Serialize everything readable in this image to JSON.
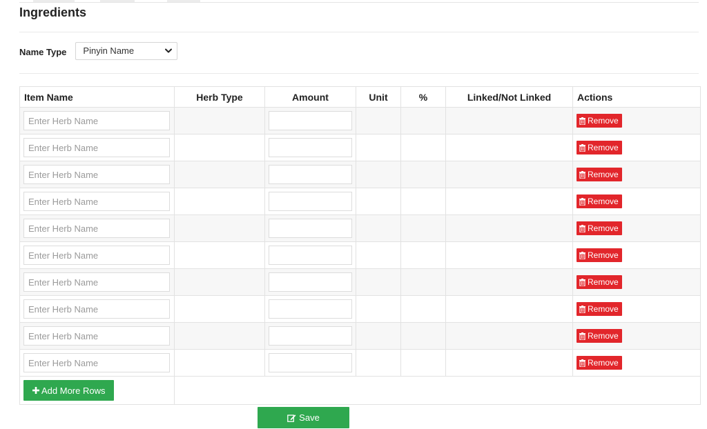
{
  "section": {
    "title": "Ingredients"
  },
  "name_type": {
    "label": "Name Type",
    "selected": "Pinyin Name"
  },
  "table": {
    "columns": [
      "Item Name",
      "Herb Type",
      "Amount",
      "Unit",
      "%",
      "Linked/Not Linked",
      "Actions"
    ],
    "row_count": 10,
    "herb_placeholder": "Enter Herb Name",
    "remove_label": "Remove"
  },
  "actions": {
    "add_rows_label": "Add More Rows",
    "save_label": "Save"
  },
  "icons": {
    "remove": "trash-icon",
    "add": "plus-icon",
    "save": "edit-icon",
    "select": "chevron-down-icon"
  },
  "colors": {
    "danger": "#e2262b",
    "success": "#2fa84f"
  }
}
